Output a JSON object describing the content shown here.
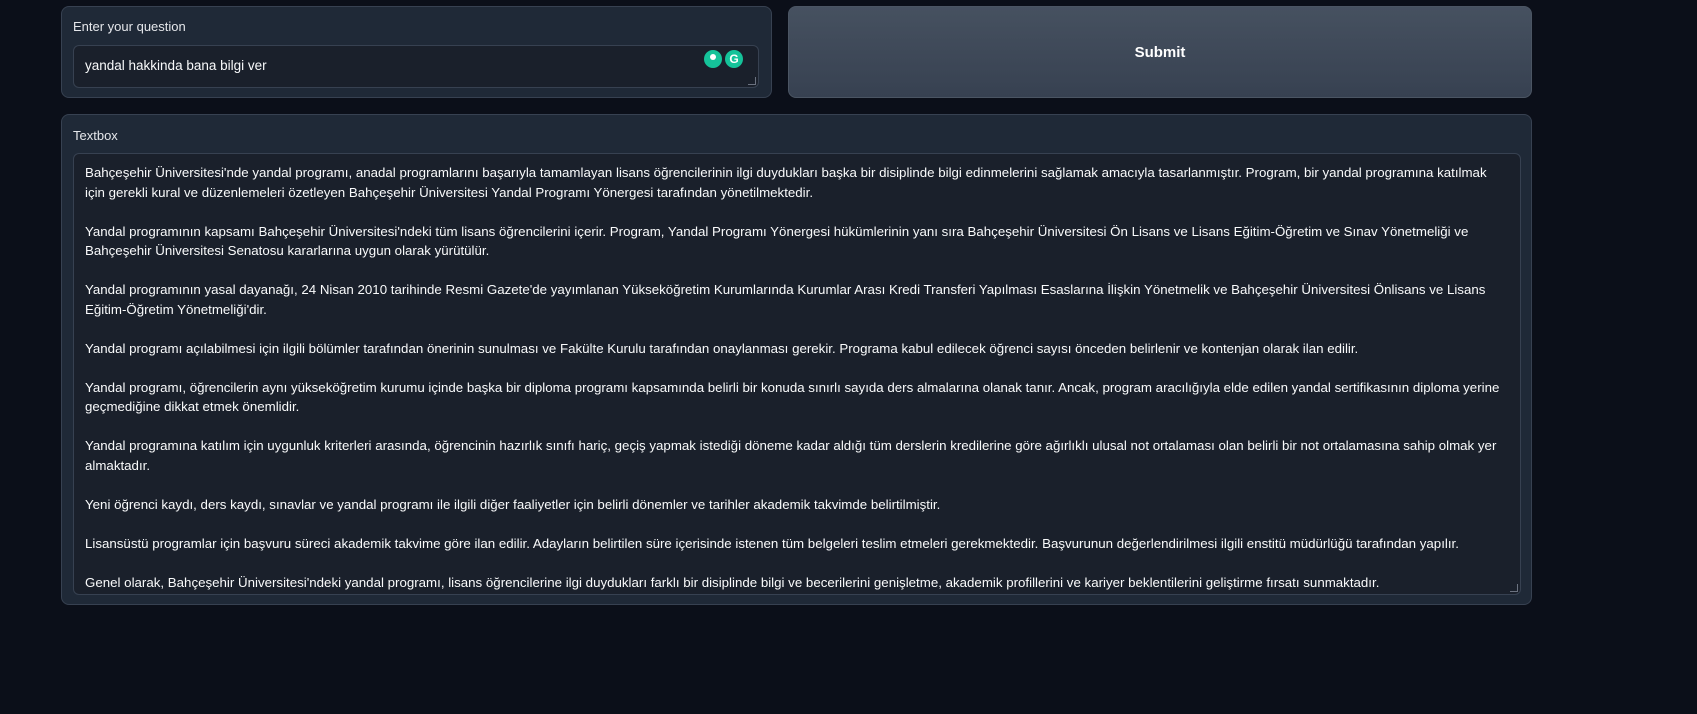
{
  "question": {
    "label": "Enter your question",
    "value": "yandal hakkinda bana bilgi ver"
  },
  "submit": {
    "label": "Submit"
  },
  "grammarly": {
    "icon": "grammarly-icon",
    "letter": "G"
  },
  "textbox": {
    "label": "Textbox",
    "paragraphs": [
      "Bahçeşehir Üniversitesi'nde yandal programı, anadal programlarını başarıyla tamamlayan lisans öğrencilerinin ilgi duydukları başka bir disiplinde bilgi edinmelerini sağlamak amacıyla tasarlanmıştır. Program, bir yandal programına katılmak için gerekli kural ve düzenlemeleri özetleyen Bahçeşehir Üniversitesi Yandal Programı Yönergesi tarafından yönetilmektedir.",
      "Yandal programının kapsamı Bahçeşehir Üniversitesi'ndeki tüm lisans öğrencilerini içerir. Program, Yandal Programı Yönergesi hükümlerinin yanı sıra Bahçeşehir Üniversitesi Ön Lisans ve Lisans Eğitim-Öğretim ve Sınav Yönetmeliği ve Bahçeşehir Üniversitesi Senatosu kararlarına uygun olarak yürütülür.",
      "Yandal programının yasal dayanağı, 24 Nisan 2010 tarihinde Resmi Gazete'de yayımlanan Yükseköğretim Kurumlarında Kurumlar Arası Kredi Transferi Yapılması Esaslarına İlişkin Yönetmelik ve Bahçeşehir Üniversitesi Önlisans ve Lisans Eğitim-Öğretim Yönetmeliği'dir.",
      "Yandal programı açılabilmesi için ilgili bölümler tarafından önerinin sunulması ve Fakülte Kurulu tarafından onaylanması gerekir. Programa kabul edilecek öğrenci sayısı önceden belirlenir ve kontenjan olarak ilan edilir.",
      "Yandal programı, öğrencilerin aynı yükseköğretim kurumu içinde başka bir diploma programı kapsamında belirli bir konuda sınırlı sayıda ders almalarına olanak tanır. Ancak, program aracılığıyla elde edilen yandal sertifikasının diploma yerine geçmediğine dikkat etmek önemlidir.",
      "Yandal programına katılım için uygunluk kriterleri arasında, öğrencinin hazırlık sınıfı hariç, geçiş yapmak istediği döneme kadar aldığı tüm derslerin kredilerine göre ağırlıklı ulusal not ortalaması olan belirli bir not ortalamasına sahip olmak yer almaktadır.",
      "Yeni öğrenci kaydı, ders kaydı, sınavlar ve yandal programı ile ilgili diğer faaliyetler için belirli dönemler ve tarihler akademik takvimde belirtilmiştir.",
      "Lisansüstü programlar için başvuru süreci akademik takvime göre ilan edilir. Adayların belirtilen süre içerisinde istenen tüm belgeleri teslim etmeleri gerekmektedir. Başvurunun değerlendirilmesi ilgili enstitü müdürlüğü tarafından yapılır.",
      "Genel olarak, Bahçeşehir Üniversitesi'ndeki yandal programı, lisans öğrencilerine ilgi duydukları farklı bir disiplinde bilgi ve becerilerini genişletme, akademik profillerini ve kariyer beklentilerini geliştirme fırsatı sunmaktadır."
    ]
  }
}
